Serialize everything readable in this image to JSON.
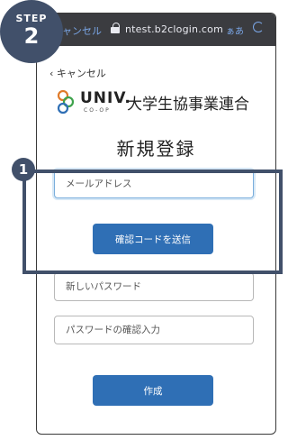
{
  "step": {
    "label": "STEP",
    "number": "2"
  },
  "browser": {
    "tab_text": "ャンセル",
    "url": "ntest.b2clogin.com",
    "text_size": "ぁあ"
  },
  "nav": {
    "back": "キャンセル"
  },
  "logo": {
    "brand": "UNIV.",
    "coop": "CO-OP",
    "org": "大学生協事業連合"
  },
  "page": {
    "title": "新規登録"
  },
  "form": {
    "email_placeholder": "メールアドレス",
    "send_code_label": "確認コードを送信",
    "password_placeholder": "新しいパスワード",
    "password_confirm_placeholder": "パスワードの確認入力",
    "create_label": "作成"
  },
  "annotation": {
    "marker": "1"
  },
  "colors": {
    "accent": "#2f6fb5",
    "badge": "#41506a",
    "browser_bar": "#3b3c40"
  }
}
